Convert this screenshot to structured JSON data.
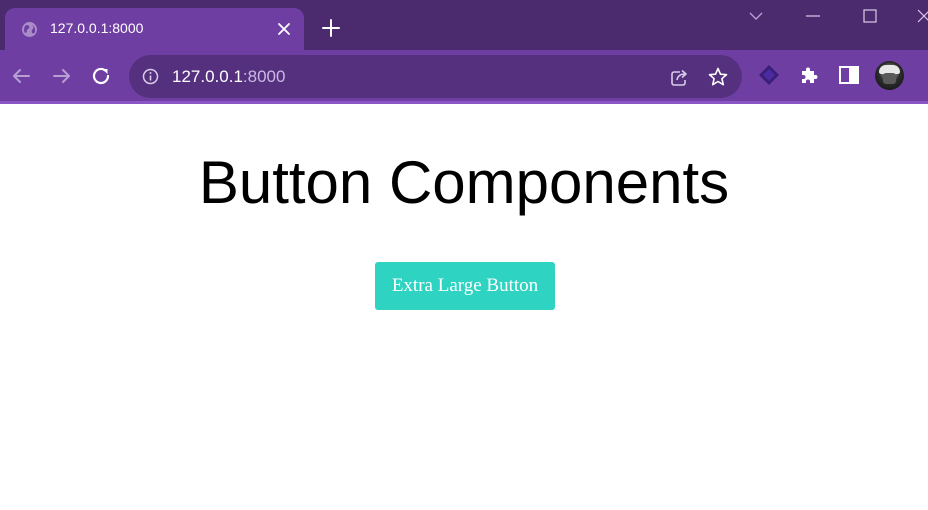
{
  "browser": {
    "tab": {
      "title": "127.0.0.1:8000",
      "favicon": "globe-icon",
      "close_icon": "close-icon"
    },
    "new_tab_icon": "plus-icon",
    "window_controls": [
      "chevron-down-icon",
      "minimize-icon",
      "maximize-icon",
      "close-window-icon"
    ],
    "address_bar": {
      "host": "127.0.0.1",
      "port": ":8000",
      "info_icon": "info-icon",
      "share_icon": "share-icon",
      "bookmark_icon": "star-icon"
    },
    "nav_icons": [
      "back-arrow-icon",
      "forward-arrow-icon",
      "reload-icon"
    ],
    "toolbar_icons": [
      "extension-diamond-icon",
      "puzzle-icon",
      "sidebar-icon",
      "avatar"
    ],
    "colors": {
      "tabstrip": "#4b2a6e",
      "toolbar": "#6f3ea3",
      "omnibox": "#55307e"
    }
  },
  "page": {
    "title": "Button Components",
    "button": {
      "label": "Extra Large Button",
      "color": "#2fd3c1"
    }
  }
}
